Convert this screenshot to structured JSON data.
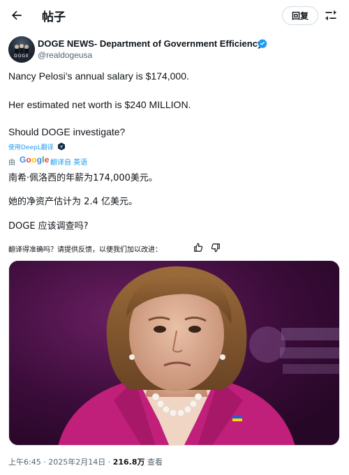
{
  "header": {
    "title": "帖子",
    "reply_label": "回复",
    "icons": {
      "back": "arrow-left-icon",
      "settings": "sliders-icon"
    }
  },
  "author": {
    "display_name": "DOGE NEWS- Department of Government Efficiency",
    "handle": "@realdogeusa",
    "avatar_label": "DOGE",
    "verified": true,
    "verified_color": "#1d9bf0"
  },
  "tweet": {
    "lines": [
      "Nancy Pelosi’s annual salary is $174,000.",
      "Her estimated net worth is $240 MILLION.",
      "Should DOGE investigate?"
    ]
  },
  "translation": {
    "deepl_link": "使用DeepL翻译",
    "by_prefix": "由",
    "google_letters": [
      "G",
      "o",
      "o",
      "g",
      "l",
      "e"
    ],
    "google_colors": [
      "#4285f4",
      "#ea4335",
      "#fbbc05",
      "#4285f4",
      "#34a853",
      "#ea4335"
    ],
    "translated_from": "翻译自 英语",
    "lines": [
      "南希·佩洛西的年薪为174,000美元。",
      "她的净资产估计为 2.4 亿美元。",
      "DOGE 应该调查吗?"
    ],
    "feedback_prompt": "翻译得准确吗？请提供反馈，以便我们加以改进：",
    "icons": {
      "up": "thumbs-up-icon",
      "down": "thumbs-down-icon"
    }
  },
  "media": {
    "alt": "",
    "background_color": "#4a0f4a"
  },
  "meta": {
    "time": "上午6:45",
    "dot1": "·",
    "date": "2025年2月14日",
    "dot2": "·",
    "views_count": "216.8万",
    "views_label": "查看"
  },
  "colors": {
    "accent": "#1d9bf0",
    "text": "#0f1419",
    "secondary": "#536471"
  }
}
